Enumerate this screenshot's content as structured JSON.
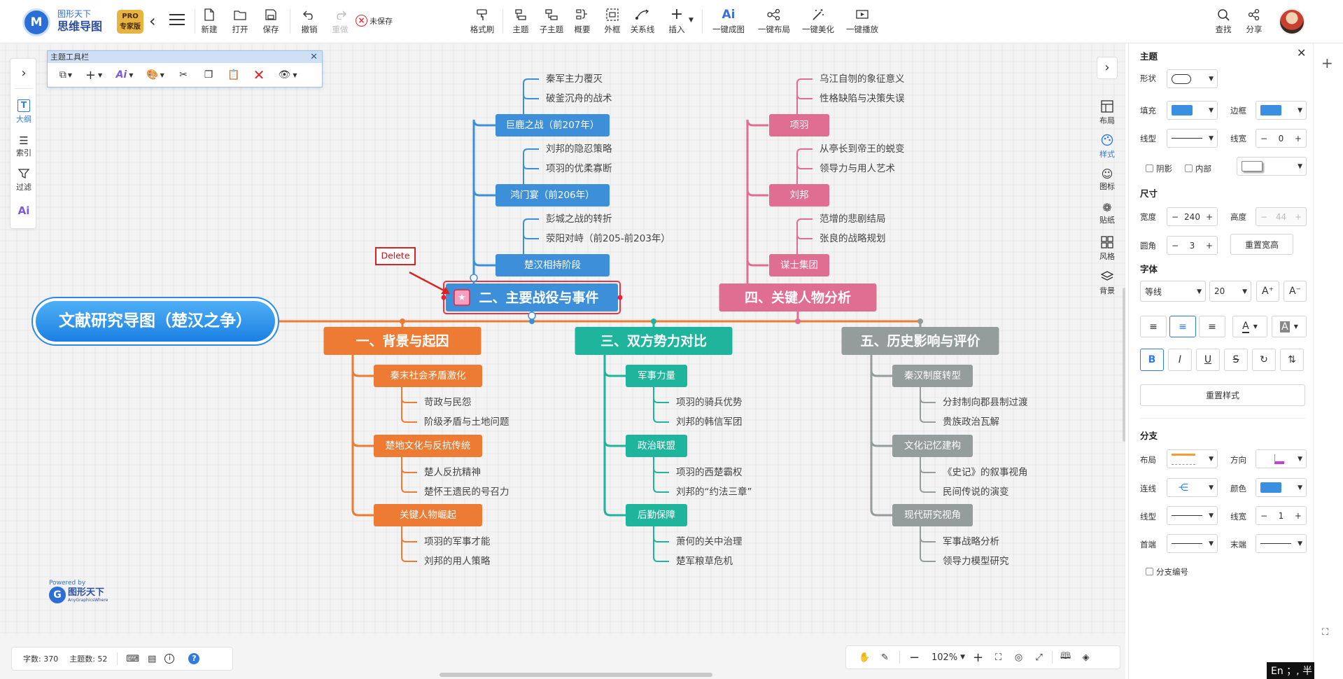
{
  "app": {
    "brand_top": "图形天下",
    "brand_name": "思维导图",
    "pro_badge_top": "PRO",
    "pro_badge_bottom": "专家版"
  },
  "toolbar": {
    "new": "新建",
    "open": "打开",
    "save": "保存",
    "undo": "撤销",
    "redo": "重做",
    "unsaved": "未保存",
    "format_brush": "格式刷",
    "topic": "主题",
    "subtopic": "子主题",
    "summary": "概要",
    "boundary": "外框",
    "relation": "关系线",
    "insert": "插入",
    "ai_generate_icon": "Ai",
    "ai_generate": "一键成图",
    "auto_layout": "一键布局",
    "beautify": "一键美化",
    "play": "一键播放",
    "find": "查找",
    "share": "分享"
  },
  "left_panel": {
    "outline": "大纲",
    "index": "索引",
    "filter": "过滤",
    "ai": "Ai"
  },
  "topic_toolbar": {
    "title": "主题工具栏"
  },
  "annotation": {
    "delete_label": "Delete"
  },
  "mindmap": {
    "root": "文献研究导图（楚汉之争）",
    "branches": [
      {
        "title": "一、背景与起因",
        "color": "#ee7b33",
        "children": [
          {
            "title": "秦末社会矛盾激化",
            "leaves": [
              "苛政与民怨",
              "阶级矛盾与土地问题"
            ]
          },
          {
            "title": "楚地文化与反抗传统",
            "leaves": [
              "楚人反抗精神",
              "楚怀王遗民的号召力"
            ]
          },
          {
            "title": "关键人物崛起",
            "leaves": [
              "项羽的军事才能",
              "刘邦的用人策略"
            ]
          }
        ]
      },
      {
        "title": "二、主要战役与事件",
        "color": "#3d8fd9",
        "children": [
          {
            "title": "楚汉相持阶段",
            "leaves": [
              "彭城之战的转折",
              "荥阳对峙（前205-前203年）"
            ]
          },
          {
            "title": "鸿门宴（前206年）",
            "leaves": [
              "刘邦的隐忍策略",
              "项羽的优柔寡断"
            ]
          },
          {
            "title": "巨鹿之战（前207年）",
            "leaves": [
              "秦军主力覆灭",
              "破釜沉舟的战术"
            ]
          }
        ]
      },
      {
        "title": "三、双方势力对比",
        "color": "#1fb49c",
        "children": [
          {
            "title": "军事力量",
            "leaves": [
              "项羽的骑兵优势",
              "刘邦的韩信军团"
            ]
          },
          {
            "title": "政治联盟",
            "leaves": [
              "项羽的西楚霸权",
              "刘邦的“约法三章”"
            ]
          },
          {
            "title": "后勤保障",
            "leaves": [
              "萧何的关中治理",
              "楚军粮草危机"
            ]
          }
        ]
      },
      {
        "title": "四、关键人物分析",
        "color": "#e06d92",
        "children": [
          {
            "title": "谋士集团",
            "leaves": [
              "范增的悲剧结局",
              "张良的战略规划"
            ]
          },
          {
            "title": "刘邦",
            "leaves": [
              "从亭长到帝王的蜕变",
              "领导力与用人艺术"
            ]
          },
          {
            "title": "项羽",
            "leaves": [
              "乌江自刎的象征意义",
              "性格缺陷与决策失误"
            ]
          }
        ]
      },
      {
        "title": "五、历史影响与评价",
        "color": "#949c9c",
        "children": [
          {
            "title": "秦汉制度转型",
            "leaves": [
              "分封制向郡县制过渡",
              "贵族政治瓦解"
            ]
          },
          {
            "title": "文化记忆建构",
            "leaves": [
              "《史记》的叙事视角",
              "民间传说的演变"
            ]
          },
          {
            "title": "现代研究视角",
            "leaves": [
              "军事战略分析",
              "领导力模型研究"
            ]
          }
        ]
      }
    ]
  },
  "right_icons": {
    "layout": "布局",
    "style": "样式",
    "icon": "图标",
    "sticker": "贴纸",
    "theme_style": "风格",
    "background": "背景"
  },
  "props": {
    "section_topic": "主题",
    "shape_label": "形状",
    "fill_label": "填充",
    "border_label": "边框",
    "line_type_label": "线型",
    "line_width_label": "线宽",
    "line_width_value": "0",
    "shadow_label": "阴影",
    "inner_label": "内部",
    "section_size": "尺寸",
    "width_label": "宽度",
    "width_value": "240",
    "height_label": "高度",
    "height_value": "44",
    "radius_label": "圆角",
    "radius_value": "3",
    "reset_size": "重置宽高",
    "section_font": "字体",
    "font_name": "等线",
    "font_size": "20",
    "reset_style": "重置样式",
    "section_branch": "分支",
    "branch_layout_label": "布局",
    "branch_direction_label": "方向",
    "branch_link_label": "连线",
    "branch_color_label": "颜色",
    "branch_line_type_label": "线型",
    "branch_line_width_label": "线宽",
    "branch_line_width_value": "1",
    "head_end_label": "首端",
    "tail_end_label": "末端",
    "branch_numbering": "分支编号",
    "fill_color": "#3b8fe0",
    "branch_color": "#3b8fe0"
  },
  "status": {
    "word_count": "字数: 370",
    "topic_count": "主题数: 52"
  },
  "zoom": {
    "level": "102%"
  },
  "powered": {
    "by": "Powered by",
    "name": "图形天下",
    "sub": "AnyGraphicsWhere"
  },
  "ime": {
    "label": "En ；, 半"
  }
}
